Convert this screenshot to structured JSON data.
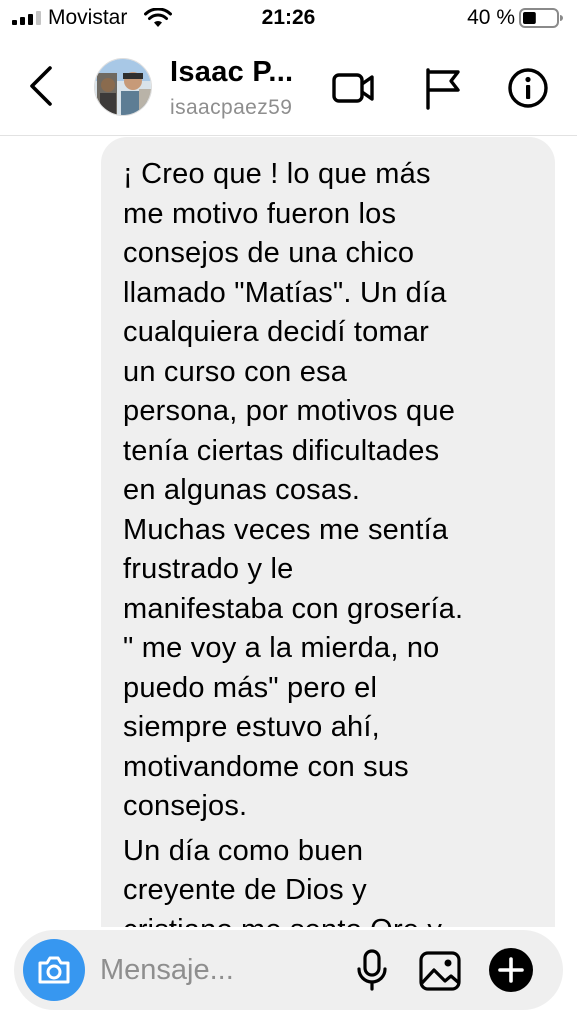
{
  "status_bar": {
    "carrier": "Movistar",
    "time": "21:26",
    "battery_percent": "40 %",
    "battery_level": 0.4,
    "signal_bars": 3,
    "signal_icon": "cellular-signal-icon",
    "wifi_icon": "wifi-icon",
    "battery_icon": "battery-icon"
  },
  "header": {
    "name": "Isaac P...",
    "username": "isaacpaez59",
    "icons": {
      "back": "chevron-left-icon",
      "video": "video-camera-icon",
      "flag": "flag-icon",
      "info": "info-icon"
    }
  },
  "message": {
    "paragraphs": [
      "¡ Creo que ! lo que más\nme motivo fueron los\nconsejos de una chico\nllamado \"Matías\". Un día\ncualquiera decidí tomar\nun curso con esa\npersona, por motivos que\ntenía ciertas dificultades\nen algunas cosas.\nMuchas veces me sentía\nfrustrado y le\nmanifestaba con grosería.\n\" me voy a la mierda, no\npuedo más\" pero el\nsiempre estuvo ahí,\nmotivandome con sus\nconsejos.",
      "Un día como buen\ncreyente de Dios y\ncristiano me sento Ore y"
    ]
  },
  "composer": {
    "placeholder": "Mensaje...",
    "icons": {
      "camera": "camera-icon",
      "mic": "microphone-icon",
      "gallery": "image-gallery-icon",
      "add": "plus-circle-icon"
    }
  },
  "colors": {
    "accent": "#3797f0",
    "bubble": "#efefef",
    "secondary_text": "#8e8e8e"
  }
}
